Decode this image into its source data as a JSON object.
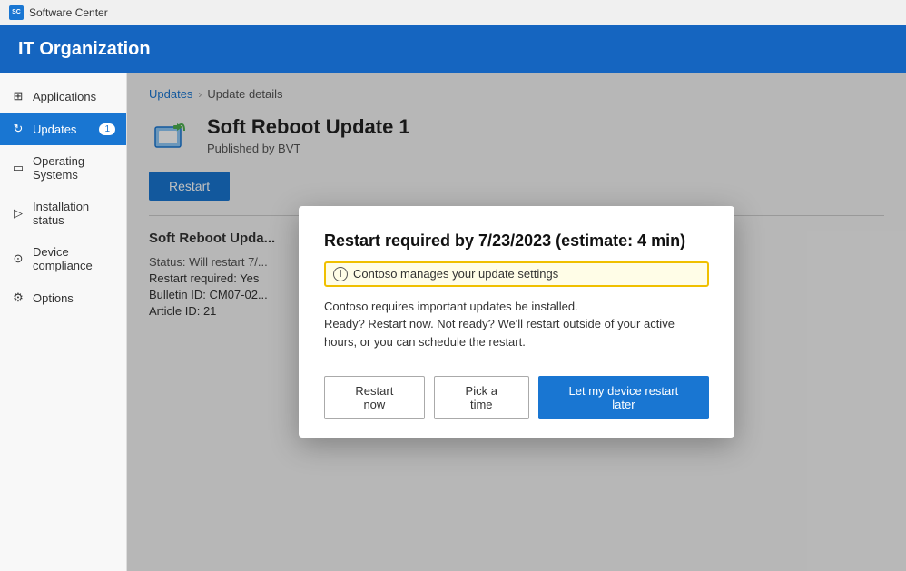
{
  "titleBar": {
    "label": "Software Center"
  },
  "header": {
    "title": "IT Organization"
  },
  "sidebar": {
    "items": [
      {
        "id": "applications",
        "label": "Applications",
        "icon": "⊞",
        "active": false,
        "badge": null
      },
      {
        "id": "updates",
        "label": "Updates",
        "icon": "↻",
        "active": true,
        "badge": "1"
      },
      {
        "id": "operating-systems",
        "label": "Operating Systems",
        "icon": "▭",
        "active": false,
        "badge": null
      },
      {
        "id": "installation-status",
        "label": "Installation status",
        "icon": "▷",
        "active": false,
        "badge": null
      },
      {
        "id": "device-compliance",
        "label": "Device compliance",
        "icon": "⊙",
        "active": false,
        "badge": null
      },
      {
        "id": "options",
        "label": "Options",
        "icon": "⚙",
        "active": false,
        "badge": null
      }
    ]
  },
  "breadcrumb": {
    "parent": "Updates",
    "separator": "›",
    "current": "Update details"
  },
  "updateDetail": {
    "title": "Soft Reboot Update 1",
    "publisher": "Published by BVT",
    "restartButtonLabel": "Restart",
    "sectionTitle": "Soft Reboot Upda...",
    "status": "Status: Will restart 7/...",
    "restartRequired": "Restart required: Yes",
    "bulletinId": "Bulletin ID: CM07-02...",
    "articleId": "Article ID: 21"
  },
  "modal": {
    "title": "Restart required by 7/23/2023 (estimate: 4 min)",
    "infoLabel": "Contoso manages your update settings",
    "body": "Contoso requires important updates be installed.\nReady? Restart now. Not ready? We'll restart outside of your active hours, or you can schedule the restart.",
    "actions": {
      "restartNow": "Restart now",
      "pickATime": "Pick a time",
      "restartLater": "Let my device restart later"
    }
  }
}
